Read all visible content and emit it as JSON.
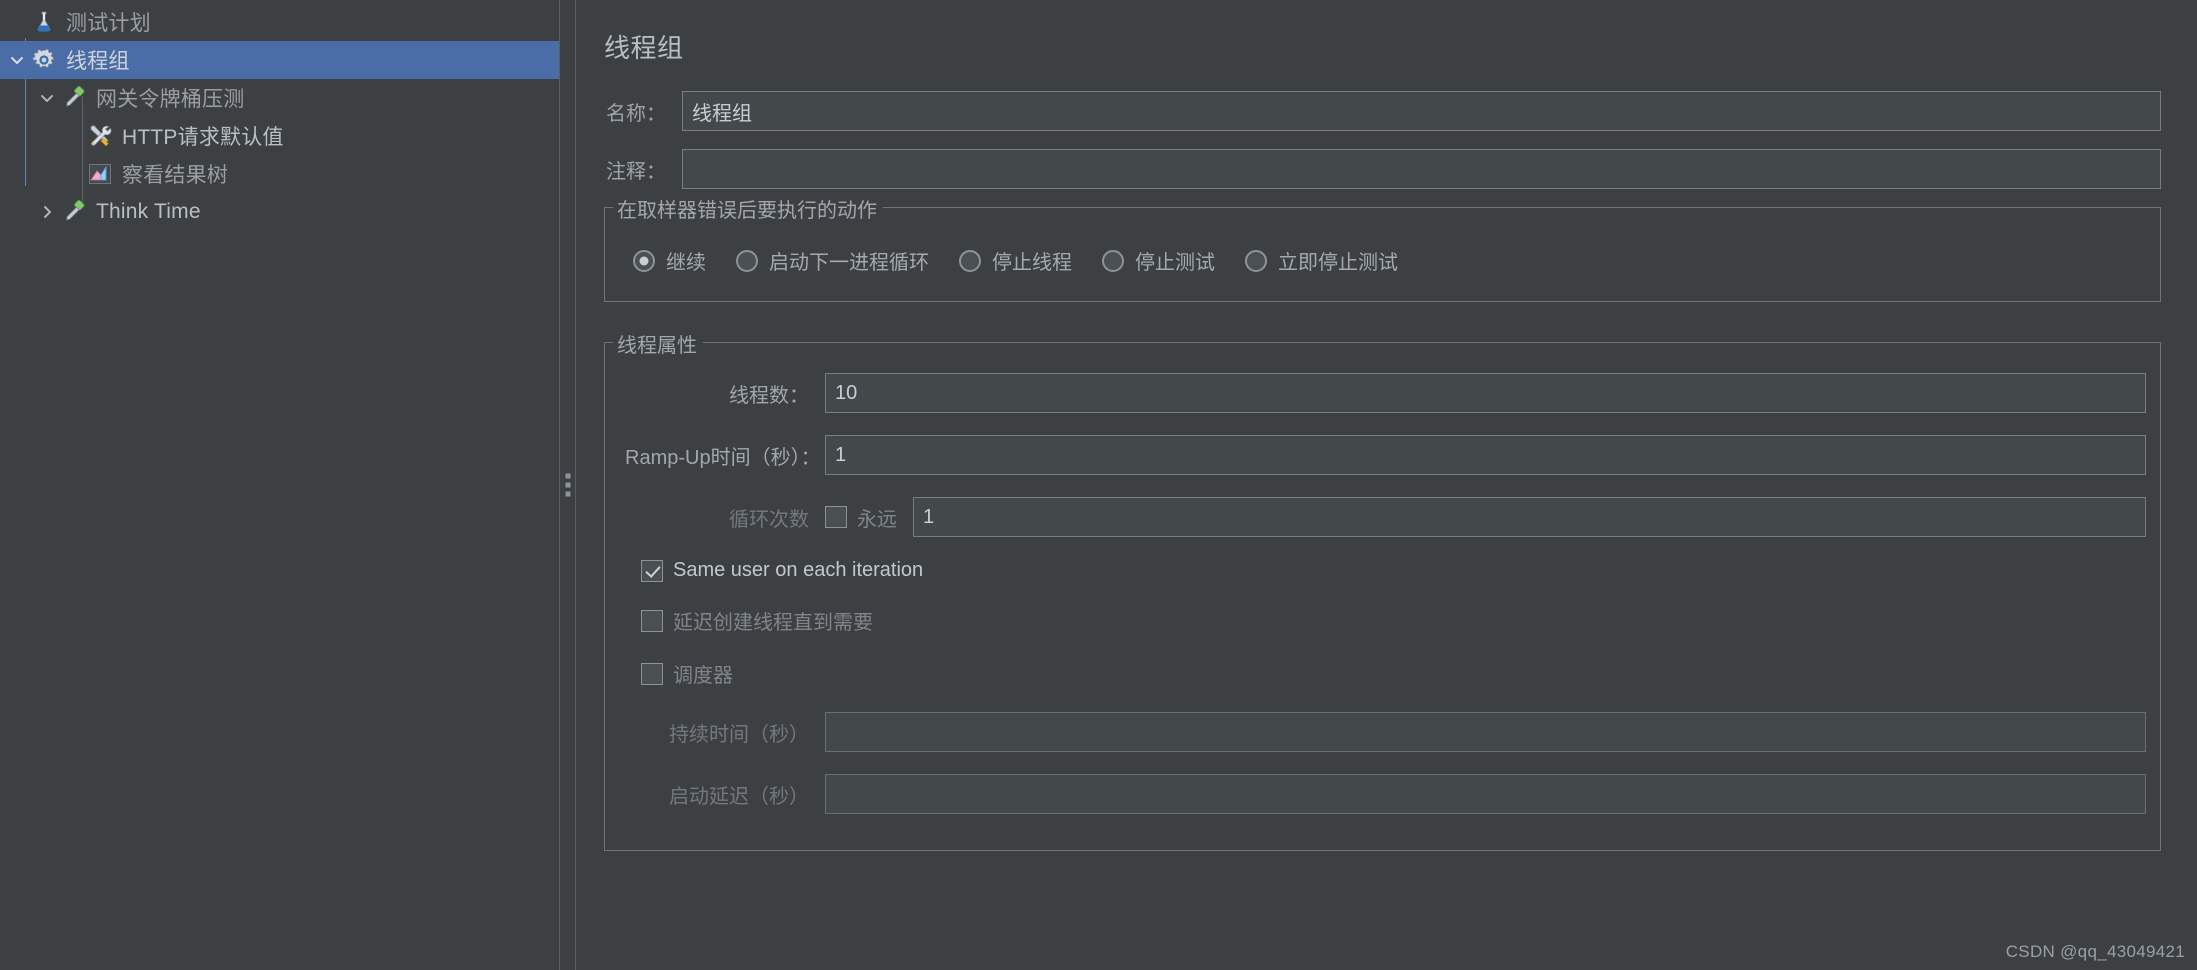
{
  "colors": {
    "background": "#3c4043",
    "selection": "#4a6da7",
    "border": "#787d82",
    "text": "#a2a7ac",
    "text_bright": "#c8ced3",
    "text_dim": "#73787d"
  },
  "tree": {
    "nodes": [
      {
        "label": "测试计划",
        "icon": "test-plan-flask-icon",
        "indent": 0,
        "twisty": "none",
        "selected": false
      },
      {
        "label": "线程组",
        "icon": "thread-group-gear-icon",
        "indent": 1,
        "twisty": "expanded",
        "selected": true
      },
      {
        "label": "网关令牌桶压测",
        "icon": "controller-dropper-icon",
        "indent": 2,
        "twisty": "expanded",
        "selected": false
      },
      {
        "label": "HTTP请求默认值",
        "icon": "config-tools-icon",
        "indent": 3,
        "twisty": "none",
        "selected": false
      },
      {
        "label": "察看结果树",
        "icon": "view-results-tree-icon",
        "indent": 3,
        "twisty": "none",
        "selected": false
      },
      {
        "label": "Think Time",
        "icon": "controller-dropper-icon",
        "indent": 2,
        "twisty": "collapsed",
        "selected": false
      }
    ]
  },
  "splitter": {
    "handle": "splitter-dots"
  },
  "panel": {
    "title": "线程组",
    "name_label": "名称：",
    "name_value": "线程组",
    "comment_label": "注释：",
    "comment_value": ""
  },
  "error_actions": {
    "legend": "在取样器错误后要执行的动作",
    "options": [
      {
        "label": "继续",
        "checked": true
      },
      {
        "label": "启动下一进程循环",
        "checked": false
      },
      {
        "label": "停止线程",
        "checked": false
      },
      {
        "label": "停止测试",
        "checked": false
      },
      {
        "label": "立即停止测试",
        "checked": false
      }
    ]
  },
  "thread_properties": {
    "legend": "线程属性",
    "num_threads_label": "线程数：",
    "num_threads_value": "10",
    "ramp_up_label": "Ramp-Up时间（秒）：",
    "ramp_up_value": "1",
    "loop_count_label": "循环次数",
    "forever_label": "永远",
    "forever_checked": false,
    "loop_count_value": "1",
    "same_user_label": "Same user on each iteration",
    "same_user_checked": true,
    "delay_thread_creation_label": "延迟创建线程直到需要",
    "delay_thread_creation_checked": false,
    "scheduler_label": "调度器",
    "scheduler_checked": false,
    "duration_label": "持续时间（秒）",
    "duration_value": "",
    "startup_delay_label": "启动延迟（秒）",
    "startup_delay_value": ""
  },
  "watermark": {
    "text": "CSDN @qq_43049421"
  }
}
